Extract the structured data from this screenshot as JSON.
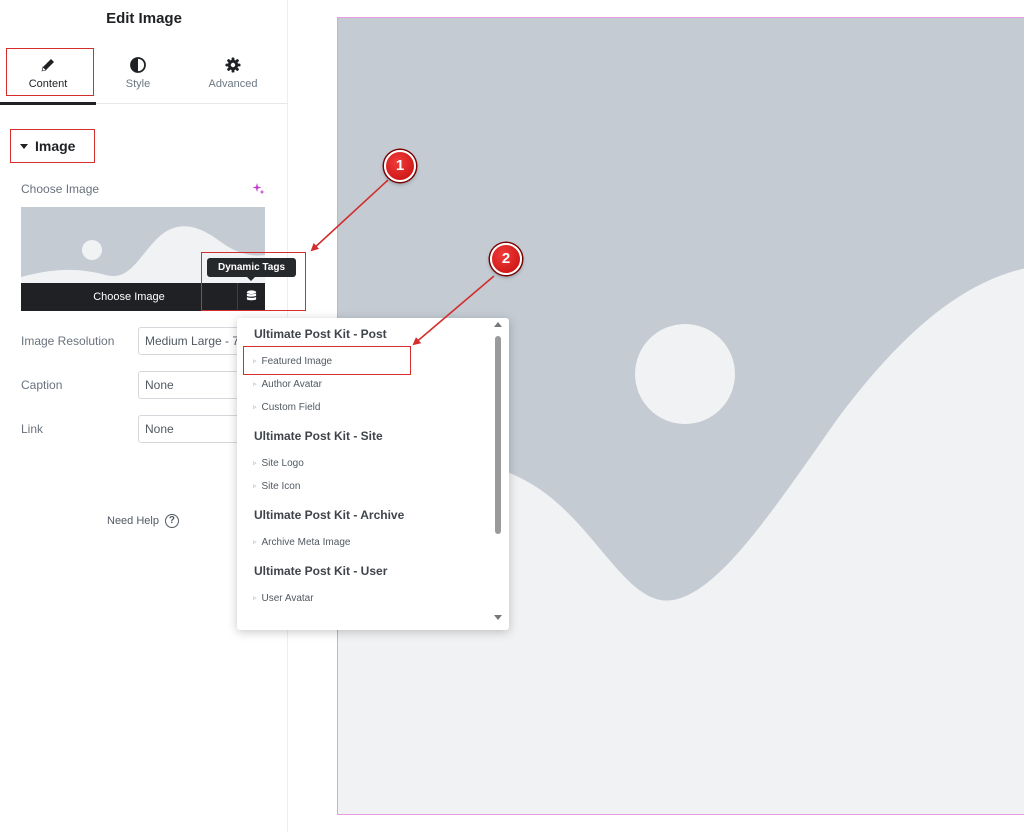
{
  "panel": {
    "title": "Edit Image",
    "tabs": [
      {
        "label": "Content",
        "icon": "pencil-icon",
        "active": true
      },
      {
        "label": "Style",
        "icon": "half-circle-icon",
        "active": false
      },
      {
        "label": "Advanced",
        "icon": "gear-icon",
        "active": false
      }
    ],
    "section": {
      "label": "Image",
      "expanded": true
    },
    "choose_image": {
      "label": "Choose Image",
      "button_label": "Choose Image",
      "dynamic_tags_icon": "database-icon",
      "ai_icon": "sparkle-icon"
    },
    "tooltip": "Dynamic Tags",
    "fields": [
      {
        "label": "Image Resolution",
        "value": "Medium Large - 7"
      },
      {
        "label": "Caption",
        "value": "None"
      },
      {
        "label": "Link",
        "value": "None"
      }
    ],
    "need_help": {
      "label": "Need Help",
      "icon": "question-circle-icon"
    }
  },
  "dropdown": {
    "groups": [
      {
        "title": "Ultimate Post Kit - Post",
        "items": [
          "Featured Image",
          "Author Avatar",
          "Custom Field"
        ]
      },
      {
        "title": "Ultimate Post Kit - Site",
        "items": [
          "Site Logo",
          "Site Icon"
        ]
      },
      {
        "title": "Ultimate Post Kit - Archive",
        "items": [
          "Archive Meta Image"
        ]
      },
      {
        "title": "Ultimate Post Kit - User",
        "items": [
          "User Avatar"
        ]
      }
    ],
    "item_bullet": "▹"
  },
  "annotations": {
    "badges": [
      "1",
      "2"
    ],
    "color": "#d32d2d"
  },
  "colors": {
    "placeholder_bg": "#c4cbd3",
    "placeholder_fg": "#f0f2f4",
    "canvas_border": "#ea9be2",
    "dark_bar": "#1f2124"
  }
}
